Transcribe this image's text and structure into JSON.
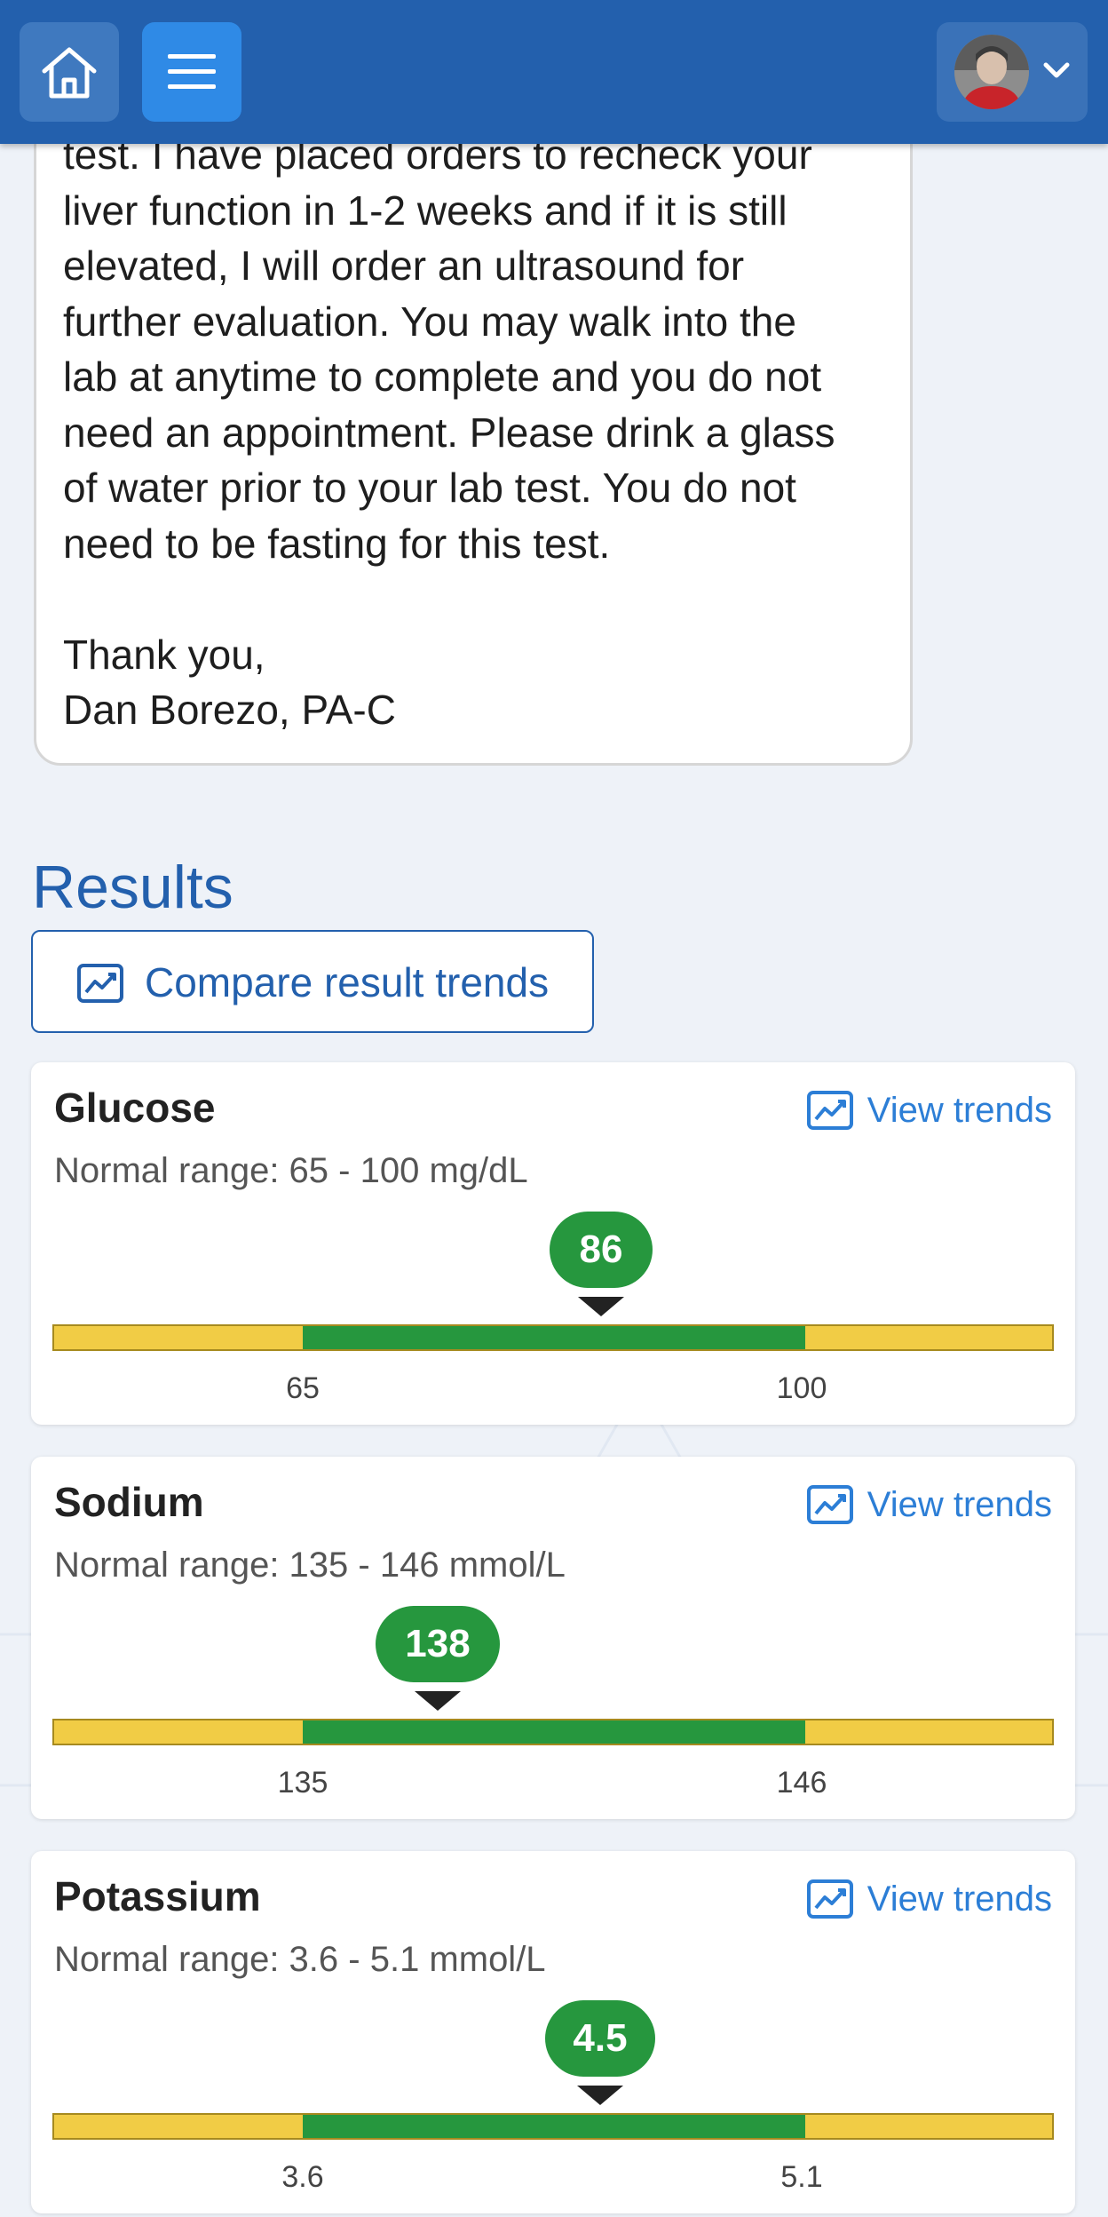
{
  "message": {
    "text": "test. I have placed orders to recheck your\nliver function in 1-2 weeks and if it is still\nelevated, I will order an ultrasound for\nfurther evaluation. You may walk into the\nlab at anytime to complete and you do not\nneed an appointment. Please drink a glass\nof water prior to your lab test. You do not\nneed to be fasting for this test.\n\nThank you,\nDan Borezo, PA-C"
  },
  "results": {
    "title": "Results",
    "compare_label": "Compare result trends",
    "items": [
      {
        "name": "Glucose",
        "view_trends": "View trends",
        "range_text": "Normal range: 65 - 100 mg/dL",
        "value": "86",
        "low": "65",
        "high": "100"
      },
      {
        "name": "Sodium",
        "view_trends": "View trends",
        "range_text": "Normal range: 135 - 146 mmol/L",
        "value": "138",
        "low": "135",
        "high": "146"
      },
      {
        "name": "Potassium",
        "view_trends": "View trends",
        "range_text": "Normal range: 3.6 - 5.1 mmol/L",
        "value": "4.5",
        "low": "3.6",
        "high": "5.1"
      }
    ]
  },
  "colors": {
    "header": "#2360ad",
    "in_range": "#26973e",
    "out_of_range": "#f1cc45",
    "link": "#2c7ed6"
  }
}
